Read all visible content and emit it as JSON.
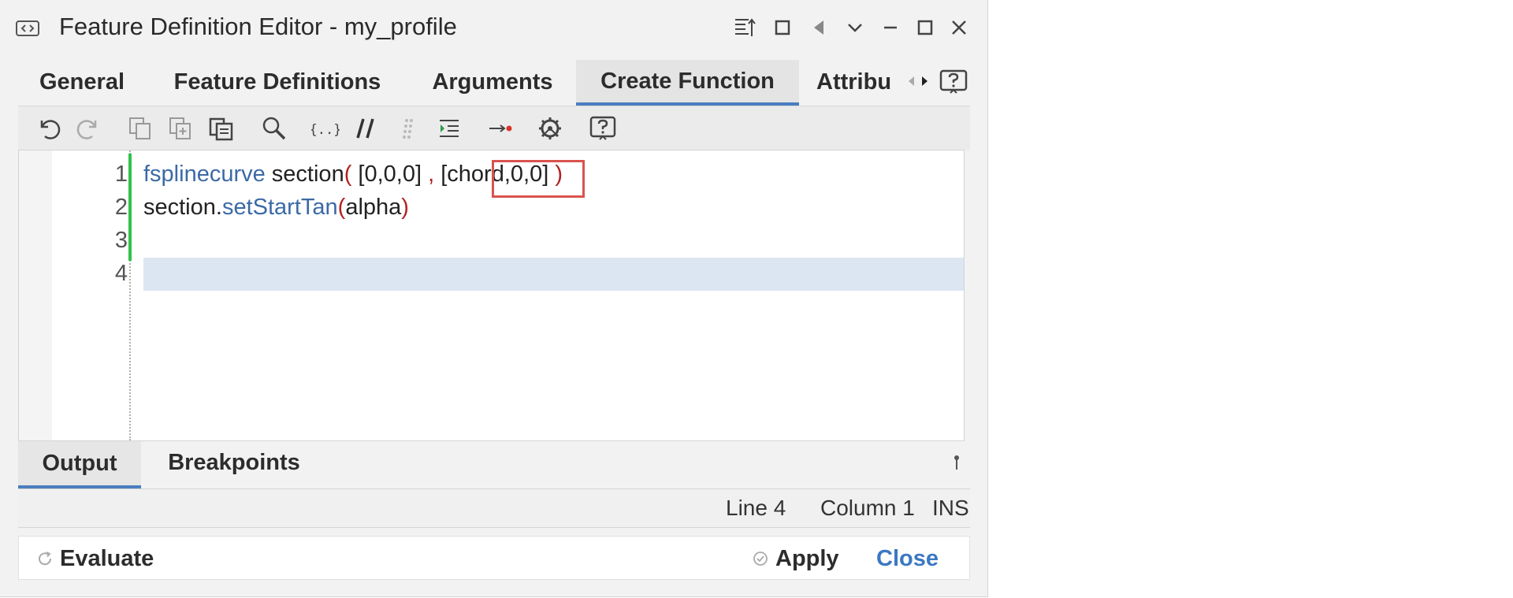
{
  "window": {
    "title": "Feature Definition Editor - my_profile"
  },
  "tabs": [
    {
      "label": "General",
      "active": false
    },
    {
      "label": "Feature Definitions",
      "active": false
    },
    {
      "label": "Arguments",
      "active": false
    },
    {
      "label": "Create Function",
      "active": true
    },
    {
      "label": "Attribu",
      "active": false
    }
  ],
  "toolbar_icons": [
    "undo-icon",
    "redo-icon",
    "copy-icon",
    "duplicate-icon",
    "paste-icon",
    "search-icon",
    "braces-icon",
    "comment-icon",
    "grip-icon",
    "indent-icon",
    "breakpoint-icon",
    "gear-icon",
    "help-icon"
  ],
  "editor": {
    "line_numbers": [
      "1",
      "2",
      "3",
      "4"
    ],
    "line1": {
      "kw": "fsplinecurve",
      "name": " section",
      "open": "(",
      "arr1": " [0,0,0] ",
      "comma": ",",
      "arr2_open": " [chord,",
      "arr2_rest": "0,0]",
      "close": " )"
    },
    "line2": {
      "obj": "section.",
      "method": "setStartTan",
      "open": "(",
      "arg": "alpha",
      "close": ")"
    }
  },
  "bottom_tabs": [
    {
      "label": "Output",
      "active": true
    },
    {
      "label": "Breakpoints",
      "active": false
    }
  ],
  "status": {
    "line": "Line 4",
    "column": "Column 1",
    "mode": "INS"
  },
  "footer": {
    "evaluate": "Evaluate",
    "apply": "Apply",
    "close": "Close"
  },
  "colors": {
    "accent": "#4a7ec0",
    "keyword": "#3b6aa6",
    "paren": "#b22222",
    "highlight": "#d9534f",
    "change_bar": "#31c24a",
    "current_line": "#dce6f2"
  }
}
